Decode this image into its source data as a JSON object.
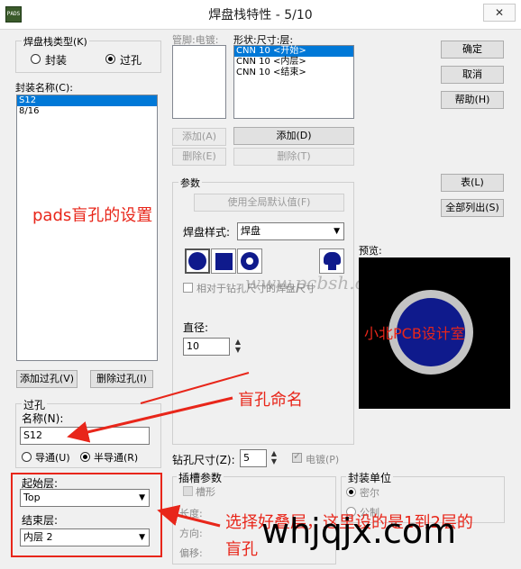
{
  "window": {
    "title": "焊盘栈特性 - 5/10",
    "app_icon_text": "PADS"
  },
  "stack_type": {
    "label": "焊盘栈类型(K)",
    "options": [
      "封装",
      "过孔"
    ],
    "selected": "过孔"
  },
  "package_list": {
    "label": "封装名称(C):",
    "items": [
      "S12",
      "8/16"
    ],
    "selected": "S12"
  },
  "pin_label": "管脚:电镀:",
  "shape_list": {
    "label": "形状:尺寸:层:",
    "items": [
      "CNN 10 <开始>",
      "CNN 10 <内层>",
      "CNN 10 <结束>"
    ],
    "selected": "CNN 10 <开始>"
  },
  "buttons": {
    "ok": "确定",
    "cancel": "取消",
    "help": "帮助(H)",
    "add_a": "添加(A)",
    "delete_e": "删除(E)",
    "add_d": "添加(D)",
    "delete_t": "删除(T)",
    "table": "表(L)",
    "list_all": "全部列出(S)",
    "add_via": "添加过孔(V)",
    "delete_via": "删除过孔(I)",
    "use_global": "使用全局默认值(F)"
  },
  "params": {
    "label": "参数",
    "pad_style_label": "焊盘样式:",
    "pad_style": "焊盘",
    "relative_drill_label": "相对于钻孔尺寸的焊盘尺寸",
    "diameter_label": "直径:",
    "diameter": "10"
  },
  "preview_label": "预览:",
  "via": {
    "group_label": "过孔",
    "name_label": "名称(N):",
    "name": "S12",
    "through": "导通(U)",
    "partial": "半导通(R)",
    "selected": "半导通(R)"
  },
  "start_layer": {
    "label": "起始层:",
    "value": "Top"
  },
  "end_layer": {
    "label": "结束层:",
    "value": "内层 2"
  },
  "drill": {
    "label": "钻孔尺寸(Z):",
    "value": "5",
    "plated_label": "电镀(P)"
  },
  "slot": {
    "label": "插槽参数",
    "slotted": "槽形",
    "length": "长度:",
    "direction": "方向:",
    "offset": "偏移:"
  },
  "units": {
    "label": "封装单位",
    "mil": "密尔",
    "metric": "公制"
  },
  "annotations": {
    "blind_setup": "pads盲孔的设置",
    "blind_name": "盲孔命名",
    "choose_layers": "选择好叠层，这里设的是1到2层的",
    "blind_via": "盲孔",
    "studio": "小北PCB设计室",
    "watermark_cn": "www.pcbsh.cn",
    "watermark_site": "whjqjx.com"
  },
  "colors": {
    "annotation": "#e8261a",
    "pad_blue": "#0f1a8c",
    "selection": "#0078d7"
  }
}
